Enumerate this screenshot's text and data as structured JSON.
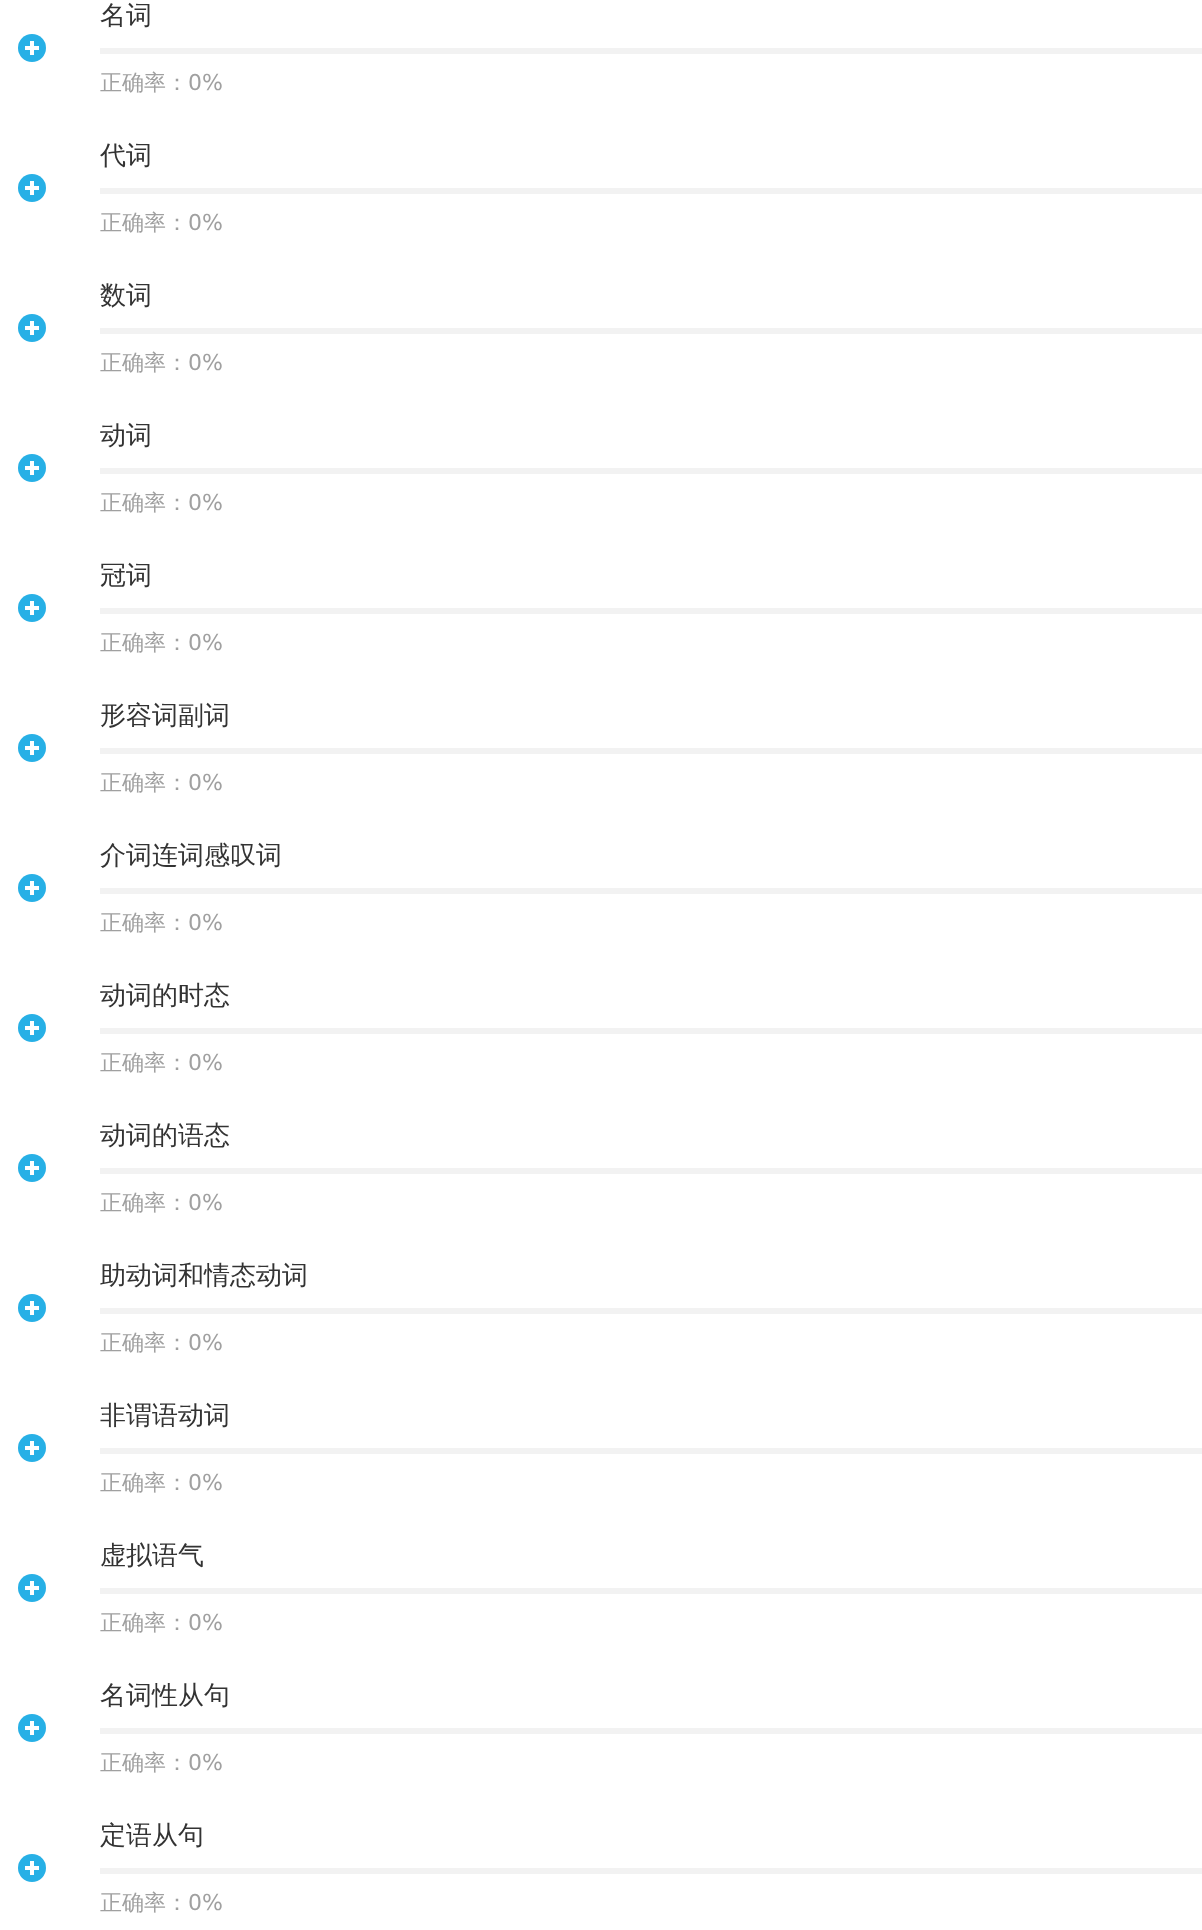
{
  "topics": [
    {
      "title": "名词",
      "accuracy": "正确率：0%"
    },
    {
      "title": "代词",
      "accuracy": "正确率：0%"
    },
    {
      "title": "数词",
      "accuracy": "正确率：0%"
    },
    {
      "title": "动词",
      "accuracy": "正确率：0%"
    },
    {
      "title": "冠词",
      "accuracy": "正确率：0%"
    },
    {
      "title": "形容词副词",
      "accuracy": "正确率：0%"
    },
    {
      "title": "介词连词感叹词",
      "accuracy": "正确率：0%"
    },
    {
      "title": "动词的时态",
      "accuracy": "正确率：0%"
    },
    {
      "title": "动词的语态",
      "accuracy": "正确率：0%"
    },
    {
      "title": "助动词和情态动词",
      "accuracy": "正确率：0%"
    },
    {
      "title": "非谓语动词",
      "accuracy": "正确率：0%"
    },
    {
      "title": "虚拟语气",
      "accuracy": "正确率：0%"
    },
    {
      "title": "名词性从句",
      "accuracy": "正确率：0%"
    },
    {
      "title": "定语从句",
      "accuracy": "正确率：0%"
    }
  ]
}
